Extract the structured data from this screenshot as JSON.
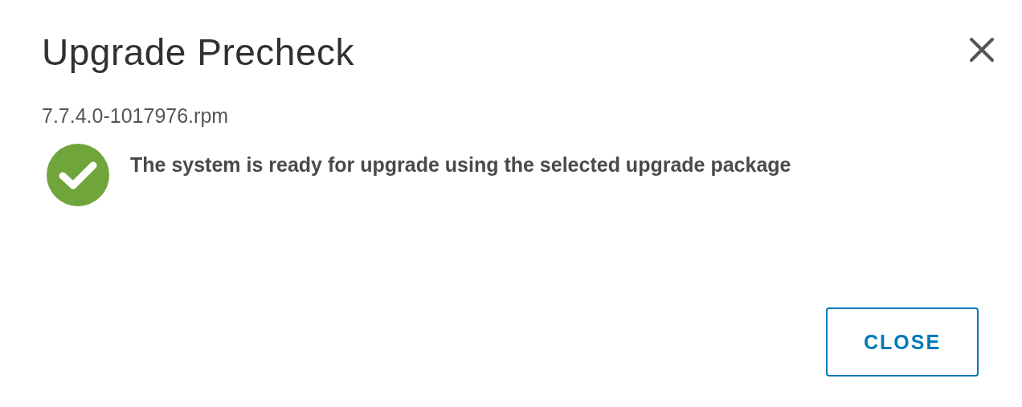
{
  "dialog": {
    "title": "Upgrade Precheck",
    "package": "7.7.4.0-1017976.rpm",
    "status": {
      "kind": "success",
      "message": "The system is ready for upgrade using the selected upgrade package"
    },
    "buttons": [
      {
        "label": "CLOSE"
      }
    ]
  }
}
